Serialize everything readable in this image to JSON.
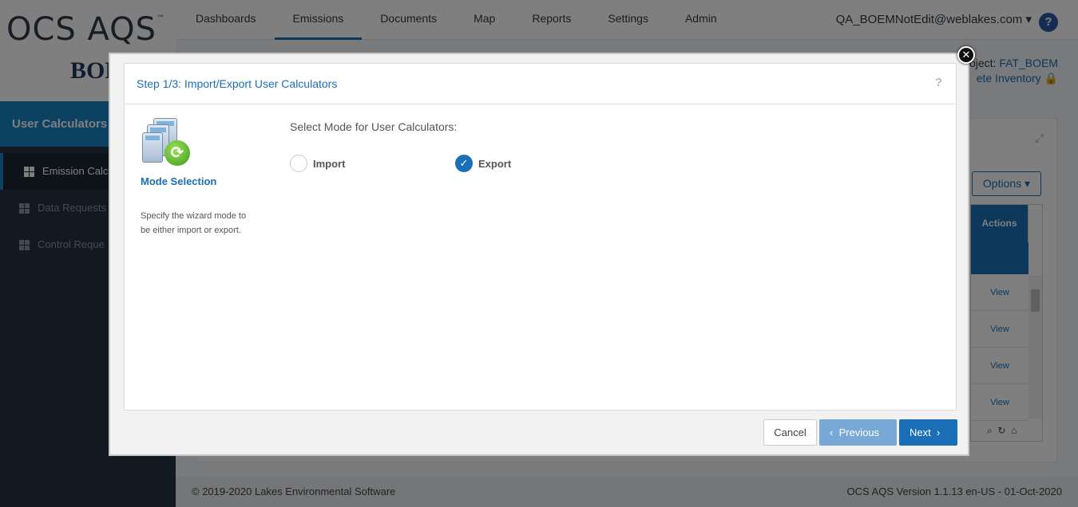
{
  "app": {
    "logo_text": "OCS AQS",
    "logo_tm": "™",
    "org_logo": "BOEM"
  },
  "nav": {
    "items": [
      {
        "label": "Dashboards"
      },
      {
        "label": "Emissions"
      },
      {
        "label": "Documents"
      },
      {
        "label": "Map"
      },
      {
        "label": "Reports"
      },
      {
        "label": "Settings"
      },
      {
        "label": "Admin"
      }
    ],
    "user": "QA_BOEMNotEdit@weblakes.com",
    "help": "?"
  },
  "project": {
    "prefix": "oject:",
    "name": "FAT_BOEM",
    "inventory": "ete Inventory"
  },
  "sidebar": {
    "header": "User Calculators",
    "items": [
      {
        "label": "Emission Calc"
      },
      {
        "label": "Data Requests"
      },
      {
        "label": "Control Reque"
      }
    ]
  },
  "background": {
    "options_label": "Options ▾",
    "actions_header": "Actions",
    "view_links": [
      "View",
      "View",
      "View",
      "View"
    ]
  },
  "footer": {
    "copyright": "© 2019-2020 Lakes Environmental Software",
    "version": "OCS AQS Version 1.1.13 en-US - 01-Oct-2020"
  },
  "modal": {
    "title": "Step 1/3: Import/Export User Calculators",
    "help": "?",
    "close": "✕",
    "step_name": "Mode Selection",
    "step_desc": "Specify the wizard mode to be either import or export.",
    "prompt": "Select Mode for User Calculators:",
    "options": [
      {
        "label": "Import",
        "checked": false
      },
      {
        "label": "Export",
        "checked": true
      }
    ],
    "buttons": {
      "cancel": "Cancel",
      "previous": "Previous",
      "next": "Next"
    }
  }
}
